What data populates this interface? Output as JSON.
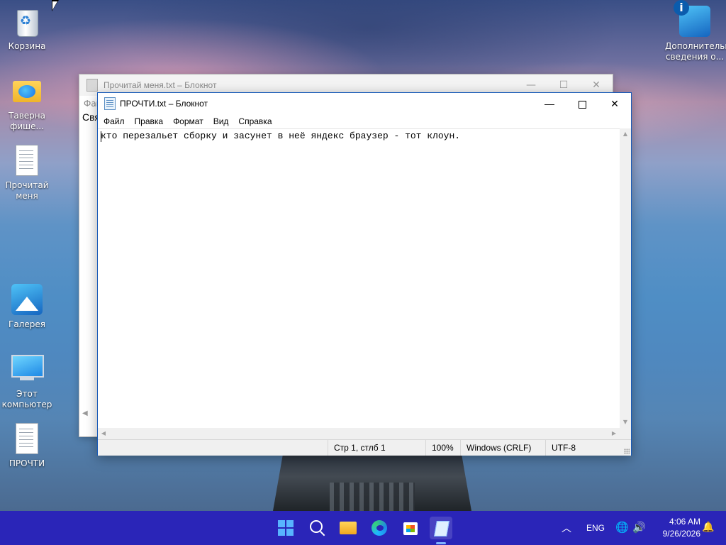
{
  "desktop": {
    "icons": [
      {
        "label": "Корзина",
        "icon": "recycle-bin-icon"
      },
      {
        "label": "Таверна фише...",
        "icon": "folder-icon"
      },
      {
        "label": "Прочитай меня",
        "icon": "text-file-icon"
      },
      {
        "label": "Галерея",
        "icon": "gallery-icon"
      },
      {
        "label": "Этот компьютер",
        "icon": "computer-icon"
      },
      {
        "label": "ПРОЧТИ",
        "icon": "text-file-icon"
      },
      {
        "label": "Дополнительные сведения о...",
        "icon": "info-icon"
      }
    ]
  },
  "back_window": {
    "title": "Прочитай меня.txt – Блокнот",
    "menu_peek": "Фай",
    "text_peek": "Свя",
    "controls": {
      "minimize": "—",
      "maximize": "☐",
      "close": "✕"
    }
  },
  "notepad": {
    "title": "ПРОЧТИ.txt – Блокнот",
    "controls": {
      "minimize": "—",
      "close": "✕"
    },
    "menu": [
      "Файл",
      "Правка",
      "Формат",
      "Вид",
      "Справка"
    ],
    "content": "кто перезальет сборку и засунет в неё яндекс браузер - тот клоун.",
    "status": {
      "position": "Стр 1, стлб 1",
      "zoom": "100%",
      "line_endings": "Windows (CRLF)",
      "encoding": "UTF-8"
    },
    "scroll_arrows": {
      "up": "▲",
      "down": "▼",
      "left": "◀",
      "right": "▶"
    }
  },
  "taskbar": {
    "apps": [
      "start-icon",
      "search-icon",
      "file-explorer-icon",
      "edge-icon",
      "store-icon",
      "notepad-icon"
    ],
    "tray": {
      "chevron": "︿",
      "language": "ENG",
      "network": "🌐",
      "volume": "🔊",
      "notification": "🔔"
    },
    "clock": {
      "time": "4:06 AM",
      "date": "9/26/2026"
    }
  },
  "colors": {
    "taskbar": "#2a25b8",
    "window_border": "#1659b8"
  }
}
